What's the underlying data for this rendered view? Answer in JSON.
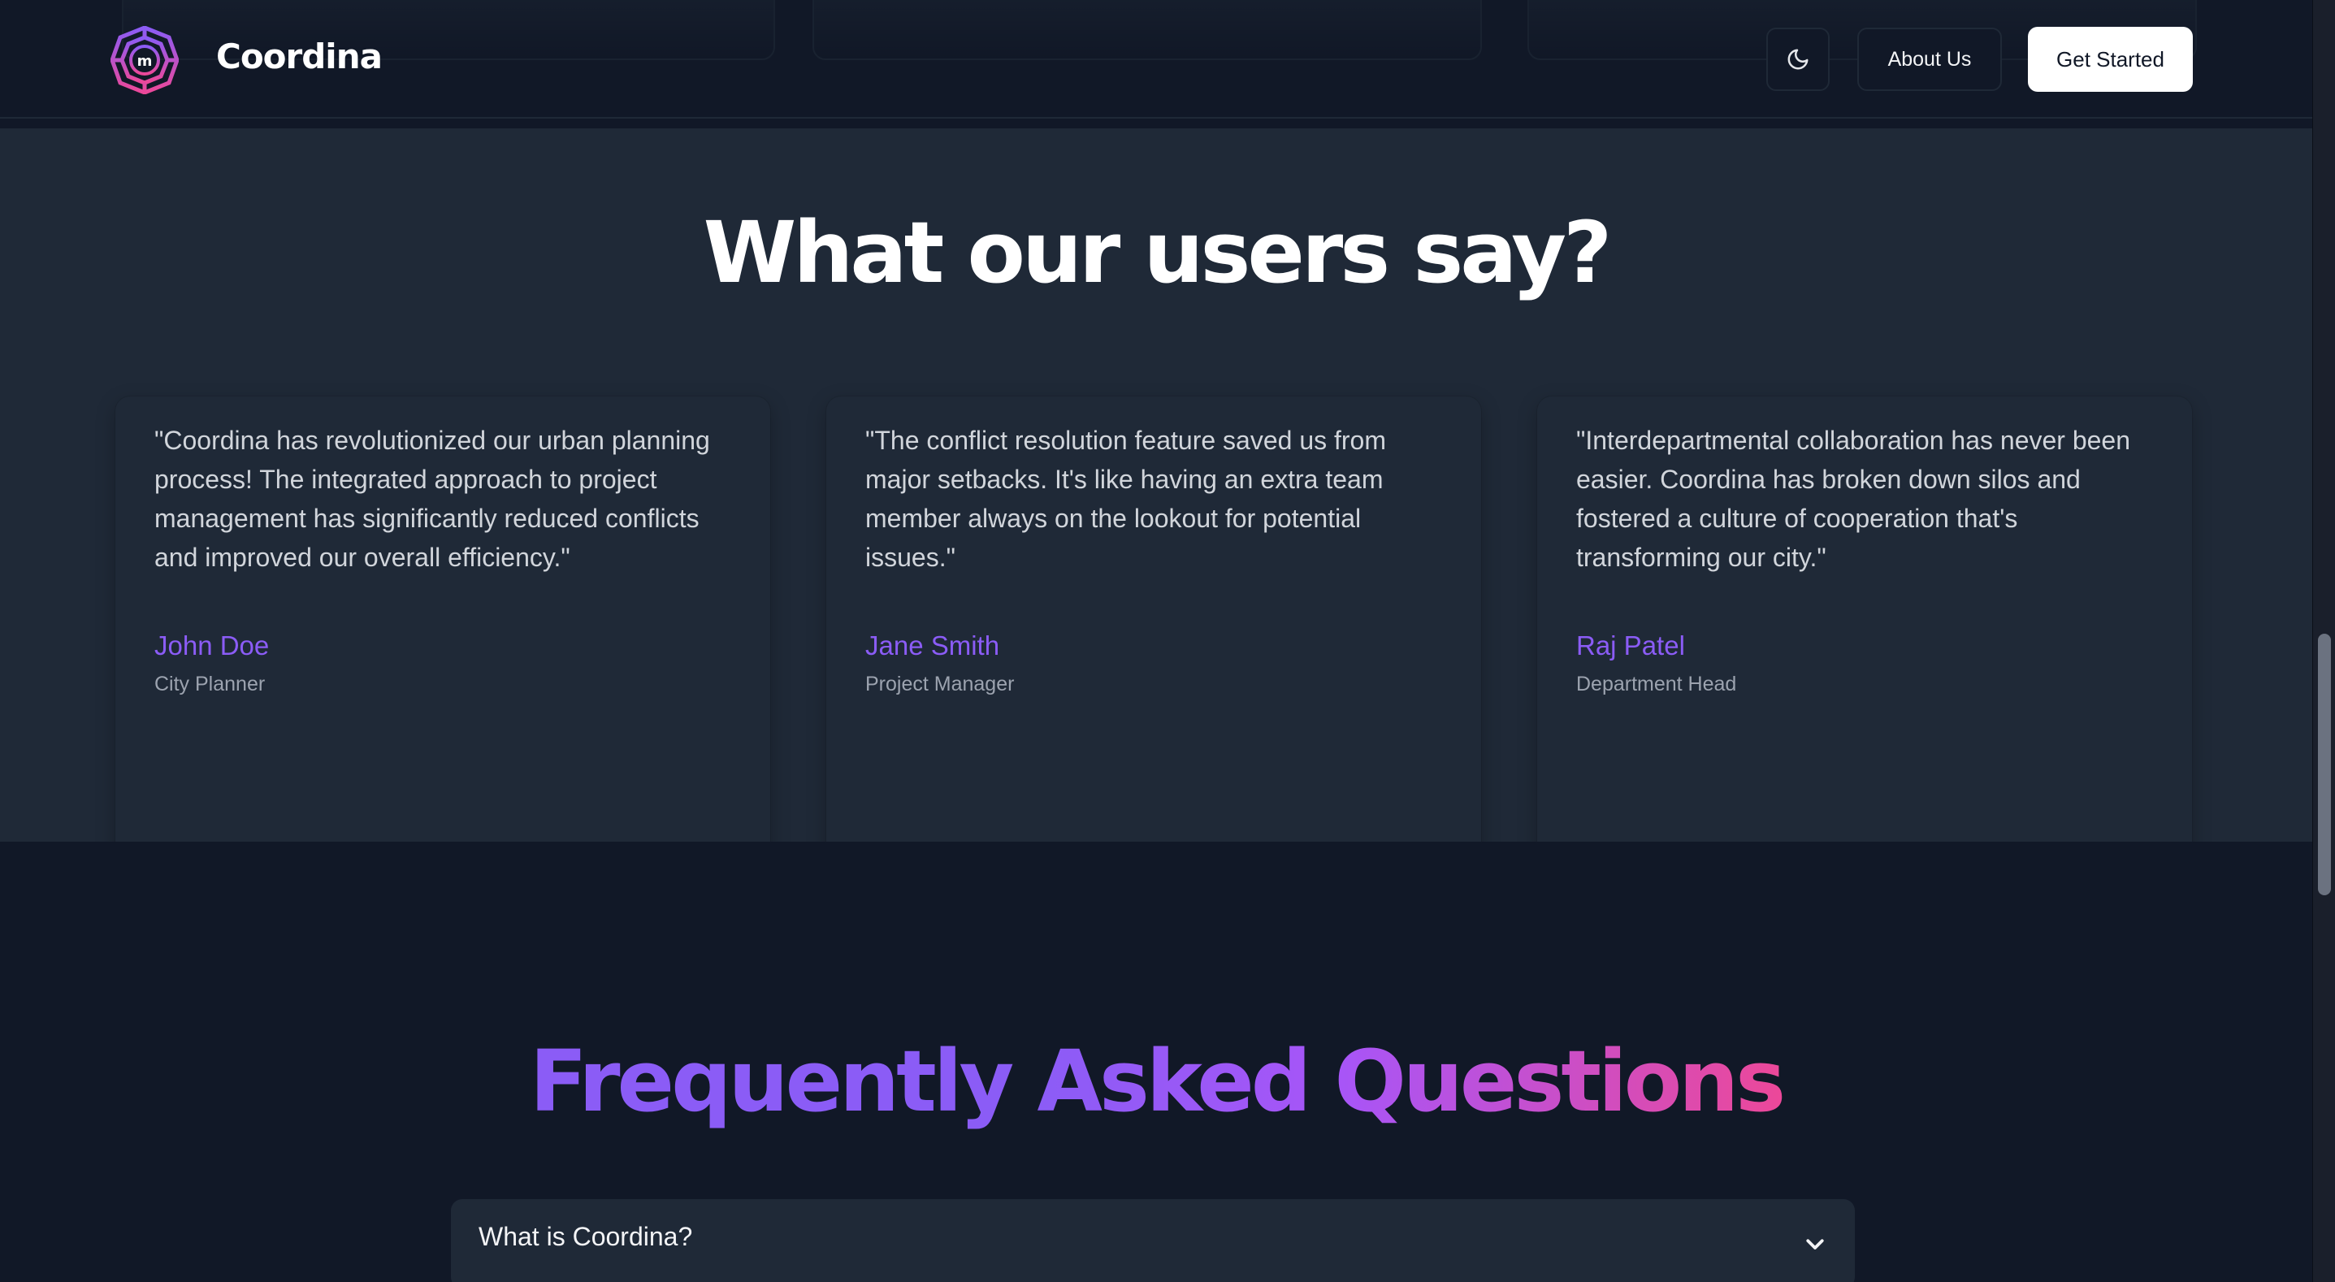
{
  "header": {
    "brand": "Coordina",
    "logo_icon": "maze-logo-icon",
    "theme_toggle_icon": "moon-icon",
    "about_label": "About Us",
    "cta_label": "Get Started"
  },
  "testimonials": {
    "title": "What our users say?",
    "items": [
      {
        "quote": "\"Coordina has revolutionized our urban planning process! The integrated approach to project management has significantly reduced conflicts and improved our overall efficiency.\"",
        "name": "John Doe",
        "role": "City Planner"
      },
      {
        "quote": "\"The conflict resolution feature saved us from major setbacks. It's like having an extra team member always on the lookout for potential issues.\"",
        "name": "Jane Smith",
        "role": "Project Manager"
      },
      {
        "quote": "\"Interdepartmental collaboration has never been easier. Coordina has broken down silos and fostered a culture of cooperation that's transforming our city.\"",
        "name": "Raj Patel",
        "role": "Department Head"
      }
    ]
  },
  "faq": {
    "title": "Frequently Asked Questions",
    "items": [
      {
        "question": "What is Coordina?",
        "icon": "chevron-down-icon"
      }
    ]
  },
  "colors": {
    "background": "#111827",
    "section_alt": "#1f2937",
    "accent": "#8b5cf6",
    "gradient_end": "#ec4899"
  }
}
